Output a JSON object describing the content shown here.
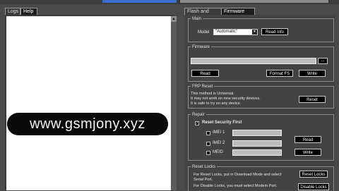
{
  "tabs_left": [
    "Logs",
    "Help"
  ],
  "tabs_right": [
    "Flash and Repair",
    "Firmware Tool"
  ],
  "watermark": "www.gsmjony.xyz",
  "main": {
    "title": "Main",
    "model_label": "Model",
    "model_value": "\"Automatic\"",
    "read_info": "Read Info"
  },
  "firmware": {
    "title": "Firmware",
    "browse": "...",
    "read": "Read",
    "format_fs": "Format FS",
    "write": "Write"
  },
  "frp": {
    "title": "FRP Reset",
    "lines": [
      "This method is Universal.",
      "It may not work on new security devices.",
      "It is safe to try on any device."
    ],
    "reset": "Reset"
  },
  "repair": {
    "title": "Repair",
    "reset_security": "Reset Security First",
    "imei1": "IMEI 1",
    "imei2": "IMEI 2",
    "meid": "MEID",
    "read": "Read",
    "write": "Write"
  },
  "reset_locks": {
    "title": "Reset Locks",
    "line1": "For Reset Locks, put in Download Mode and select",
    "line2": "Serial Port.",
    "line3": "For Disable Locks, you must select Modem Port.",
    "reset_locks_btn": "Reset Locks",
    "disable_locks_btn": "Disable Locks"
  },
  "icons": {
    "scroll_up": "up-arrow",
    "dropdown": "chevron-down",
    "checkbox": "check"
  }
}
